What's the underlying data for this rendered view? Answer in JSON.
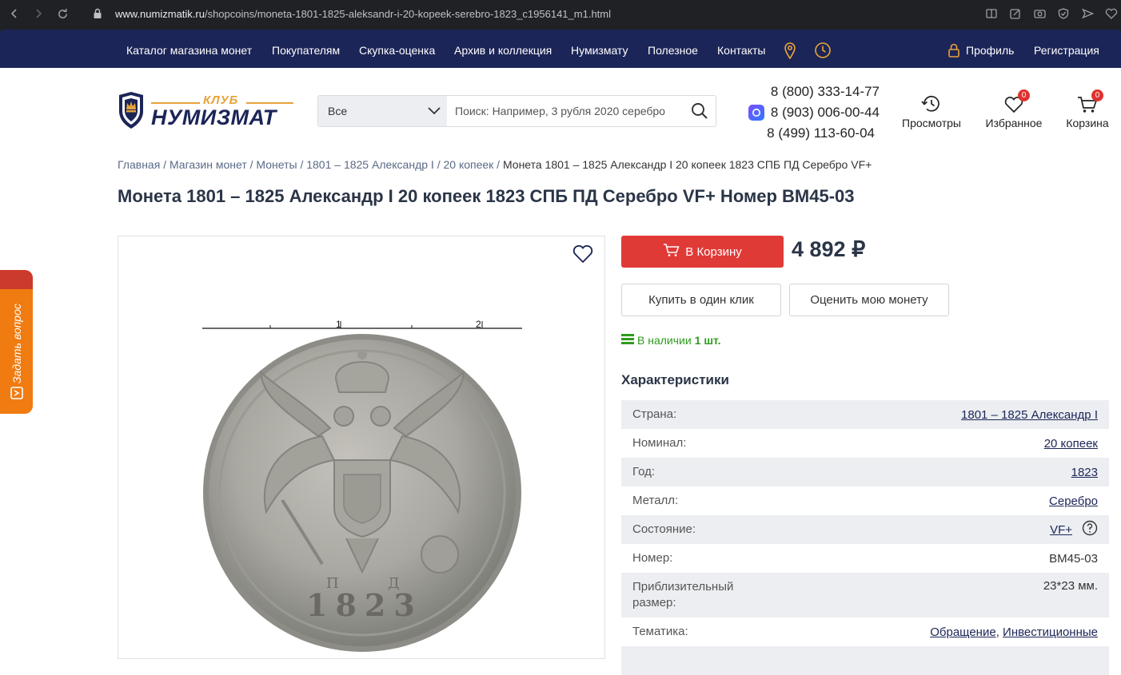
{
  "browser": {
    "url_domain": "www.numizmatik.ru",
    "url_path": "/shopcoins/moneta-1801-1825-aleksandr-i-20-kopeek-serebro-1823_c1956141_m1.html"
  },
  "topnav": {
    "items": [
      "Каталог магазина монет",
      "Покупателям",
      "Скупка-оценка",
      "Архив и коллекция",
      "Нумизмату",
      "Полезное",
      "Контакты"
    ],
    "profile": "Профиль",
    "register": "Регистрация"
  },
  "logo": {
    "top": "КЛУБ",
    "main": "НУМИЗМАТ"
  },
  "search": {
    "category": "Все",
    "placeholder": "Поиск: Например, 3 рубля 2020 серебро"
  },
  "phones": [
    "8 (800) 333-14-77",
    "8 (903) 006-00-44",
    "8 (499) 113-60-04"
  ],
  "header_icons": {
    "views": "Просмотры",
    "favorites": "Избранное",
    "favorites_count": "0",
    "cart": "Корзина",
    "cart_count": "0"
  },
  "breadcrumb": {
    "items": [
      "Главная",
      "Магазин монет",
      "Монеты",
      "1801 – 1825 Александр I",
      "20 копеек"
    ],
    "separator": " / ",
    "current": "Монета 1801 – 1825 Александр I 20 копеек 1823 СПБ ПД Серебро VF+"
  },
  "title": "Монета 1801 – 1825 Александр I 20 копеек 1823 СПБ ПД Серебро VF+ Номер BM45-03",
  "image": {
    "scale_labels": [
      "1",
      "2"
    ],
    "coin_date": "1823",
    "mint_left": "П",
    "mint_right": "Д"
  },
  "side_tab": "Задать вопрос",
  "product": {
    "buy_label": "В Корзину",
    "price": "4 892 ₽",
    "one_click": "Купить в один клик",
    "evaluate": "Оценить мою монету",
    "stock_text": "В наличии",
    "stock_qty": "1 шт."
  },
  "specs": {
    "title": "Характеристики",
    "rows": [
      {
        "label": "Страна:",
        "value": "1801 – 1825 Александр I"
      },
      {
        "label": "Номинал:",
        "value": "20 копеек"
      },
      {
        "label": "Год:",
        "value": "1823"
      },
      {
        "label": "Металл:",
        "value": "Серебро"
      },
      {
        "label": "Состояние:",
        "value": "VF+"
      },
      {
        "label": "Номер:",
        "value": "BM45-03"
      },
      {
        "label": "Приблизительный размер:",
        "value": "23*23 мм."
      },
      {
        "label": "Тематика:",
        "value": "Обращение",
        "value2": "Инвестиционные"
      }
    ]
  }
}
